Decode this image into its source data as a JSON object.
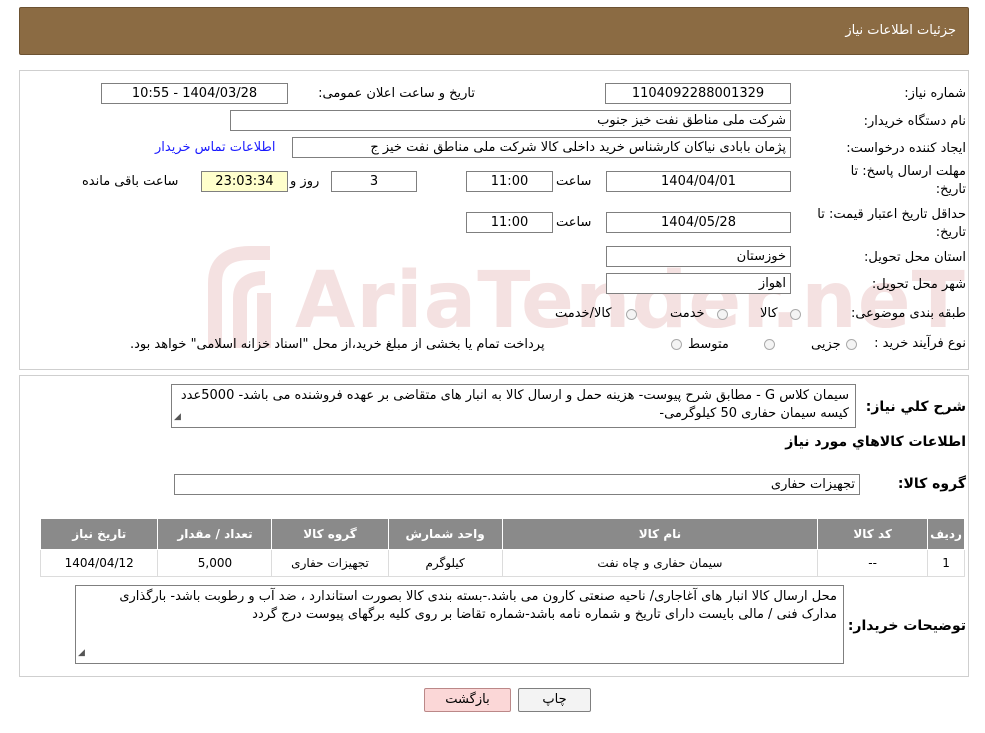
{
  "header": {
    "title": "جزئیات اطلاعات نیاز"
  },
  "form": {
    "need_number": {
      "label": "شماره نیاز:",
      "value": "1104092288001329"
    },
    "announce_datetime": {
      "label": "تاریخ و ساعت اعلان عمومی:",
      "value": "1404/03/28 - 10:55"
    },
    "buyer_org": {
      "label": "نام دستگاه خریدار:",
      "value": "شرکت ملی مناطق نفت خیز جنوب"
    },
    "requester": {
      "label": "ایجاد کننده درخواست:",
      "value": "پژمان  بابادی نیاکان  کارشناس خرید داخلی کالا  شرکت ملی مناطق نفت خیز ج",
      "contact_link": "اطلاعات تماس خریدار"
    },
    "deadline": {
      "label_line1": "مهلت ارسال پاسخ: تا",
      "label_line2": "تاریخ:",
      "date": "1404/04/01",
      "time_label": "ساعت",
      "time": "11:00",
      "days": "3",
      "days_label": "روز و",
      "remaining": "23:03:34",
      "remaining_label": "ساعت باقی مانده"
    },
    "price_validity": {
      "label_line1": "حداقل تاریخ اعتبار قیمت: تا",
      "label_line2": "تاریخ:",
      "date": "1404/05/28",
      "time_label": "ساعت",
      "time": "11:00"
    },
    "province": {
      "label": "استان محل تحویل:",
      "value": "خوزستان"
    },
    "city": {
      "label": "شهر محل تحویل:",
      "value": "اهواز"
    },
    "category": {
      "label": "طبقه بندی موضوعی:",
      "options": [
        "کالا",
        "خدمت",
        "کالا/خدمت"
      ]
    },
    "process_type": {
      "label": "نوع فرآیند خرید :",
      "options": [
        "جزیی",
        "متوسط"
      ],
      "note": "پرداخت تمام یا بخشی از مبلغ خرید،از محل \"اسناد خزانه اسلامی\" خواهد بود."
    }
  },
  "description": {
    "label": "شرح کلي نياز:",
    "text": "سیمان کلاس G - مطابق شرح پیوست- هزینه حمل و ارسال کالا به انبار های  متقاضی بر عهده فروشنده می باشد- 5000عدد کیسه سیمان حفاری 50 کیلوگرمی-"
  },
  "items_section": {
    "title": "اطلاعات کالاهاي مورد نياز",
    "group_label": "گروه کالا:",
    "group_value": "تجهیزات حفاری",
    "columns": [
      "ردیف",
      "کد کالا",
      "نام کالا",
      "واحد شمارش",
      "گروه کالا",
      "تعداد / مقدار",
      "تاریخ نیاز"
    ],
    "rows": [
      {
        "row": "1",
        "code": "--",
        "name": "سیمان حفاری و چاه نفت",
        "unit": "کیلوگرم",
        "group": "تجهیزات حفاری",
        "qty": "5,000",
        "date": "1404/04/12"
      }
    ]
  },
  "buyer_notes": {
    "label": "توضیحات خریدار:",
    "text": "محل ارسال کالا انبار های آغاجاری/ ناحیه صنعتی کارون می باشد.-بسته بندی کالا بصورت استاندارد ، ضد آب و رطوبت باشد- بارگذاری مدارک  فنی / مالی بایست دارای تاریخ و شماره نامه باشد-شماره تقاضا بر روی کلیه برگهای پیوست درج گردد"
  },
  "buttons": {
    "print": "چاپ",
    "back": "بازگشت"
  },
  "watermark": {
    "text": "AriaTender.neT",
    "color": "#b22222"
  }
}
